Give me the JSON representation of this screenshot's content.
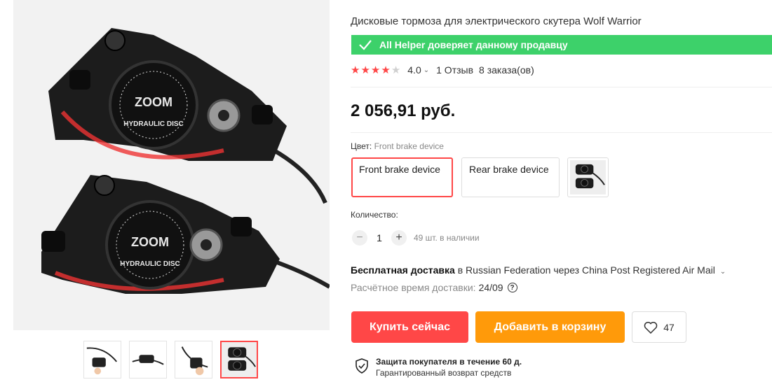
{
  "product": {
    "title": "Дисковые тормоза для электрического скутера Wolf Warrior",
    "trust_text": "All Helper доверяет данному продавцу",
    "rating": {
      "stars_filled": 4,
      "stars_total": 5,
      "value": "4.0",
      "reviews": "1 Отзыв",
      "orders": "8 заказа(ов)"
    },
    "price": "2 056,91 руб.",
    "color": {
      "label": "Цвет:",
      "selected": "Front brake device",
      "options": [
        "Front brake device",
        "Rear brake device"
      ]
    },
    "quantity": {
      "label": "Количество:",
      "minus": "−",
      "plus": "+",
      "value": "1",
      "stock": "49 шт. в наличии"
    },
    "delivery": {
      "free": "Бесплатная доставка",
      "details": "в Russian Federation через China Post Registered Air Mail",
      "eta_label": "Расчётное время доставки:",
      "eta_value": "24/09",
      "help": "?"
    },
    "buttons": {
      "buy": "Купить сейчас",
      "cart": "Добавить в корзину",
      "wishlist_count": "47"
    },
    "protection": {
      "title": "Защита покупателя в течение 60 д.",
      "subtitle": "Гарантированный возврат средств"
    }
  },
  "gallery": {
    "main_photo_text": [
      "ZOOM",
      "HYDRAULIC DISC"
    ],
    "thumbnails": [
      "thumb-1",
      "thumb-2",
      "thumb-3",
      "thumb-4"
    ],
    "active_thumb": 4
  },
  "colors": {
    "accent_red": "#ff4747",
    "accent_orange": "#ff9a0a",
    "trust_green": "#3dd16a"
  }
}
